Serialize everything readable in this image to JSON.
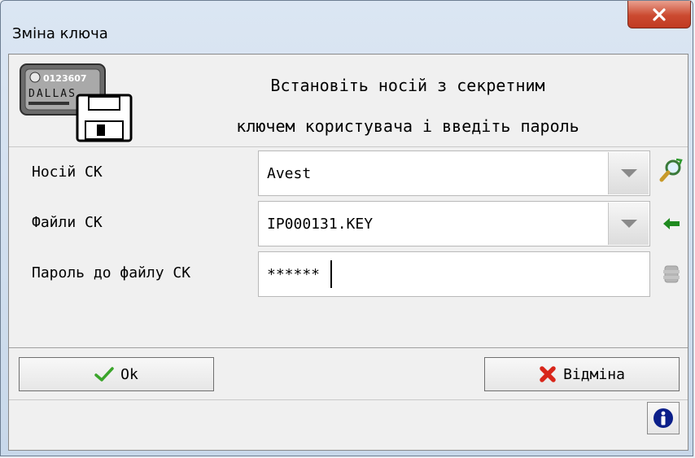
{
  "window": {
    "title": "Зміна ключа",
    "close_glyph": "✕"
  },
  "header": {
    "icon": "dallas-key-floppy-icon",
    "key_serial": "0123607",
    "key_brand": "DALLAS",
    "message_line1": "Встановіть носій з секретним",
    "message_line2": "ключем користувача і введіть пароль"
  },
  "form": {
    "carrier": {
      "label": "Носій СК",
      "value": "Avest"
    },
    "files": {
      "label": "Файли СК",
      "value": "IP000131.KEY"
    },
    "password": {
      "label": "Пароль до файлу СК",
      "value": "******"
    }
  },
  "side_icons": [
    "search-refresh-icon",
    "back-arrow-icon",
    "disabled-gear-icon"
  ],
  "buttons": {
    "ok": "Ok",
    "cancel": "Відміна",
    "info_icon": "info-icon"
  }
}
